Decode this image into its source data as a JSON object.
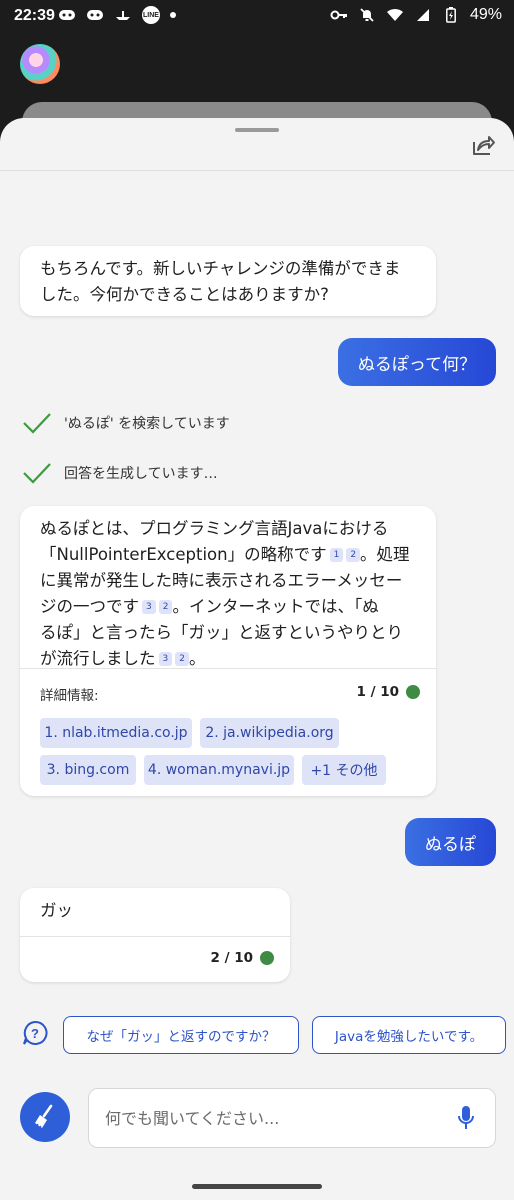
{
  "status_bar": {
    "time": "22:39",
    "line_label": "LINE",
    "battery": "49%"
  },
  "conversation": {
    "bot_greeting": [
      "もちろんです。新しいチャレンジの準備ができま",
      "した。今何かできることはありますか?"
    ],
    "user_question": "ぬるぽって何？",
    "status_searching": "'ぬるぽ' を検索しています",
    "status_generating": "回答を生成しています…",
    "answer": {
      "line1": "ぬるぽとは、プログラミング言語Javaにおける",
      "line2": "「NullPointerException」の略称です",
      "line3": "。処理",
      "line4": "に異常が発生した時に表示されるエラーメッセー",
      "line5a": "ジの一つです",
      "line5b": "。インターネットでは、「ぬ",
      "line6": "るぽ」と言ったら「ガッ」と返すというやりとり",
      "line7a": "が流行しました",
      "line7b": "。",
      "cites": [
        "1",
        "2",
        "3",
        "2",
        "3",
        "2"
      ],
      "details_label": "詳細情報:",
      "count": "1 / 10",
      "sources": [
        "1. nlab.itmedia.co.jp",
        "2. ja.wikipedia.org",
        "3. bing.com",
        "4. woman.mynavi.jp",
        "+1 その他"
      ]
    },
    "user_reply": "ぬるぽ",
    "bot_reply": "ガッ",
    "bot_reply_count": "2 / 10"
  },
  "suggestions": [
    "なぜ「ガッ」と返すのですか？",
    "Javaを勉強したいです。"
  ],
  "composer": {
    "placeholder": "何でも聞いてください..."
  },
  "colors": {
    "accent": "#2f5fd8",
    "check": "#3f9a3f",
    "status_dot": "#3f8b43"
  }
}
